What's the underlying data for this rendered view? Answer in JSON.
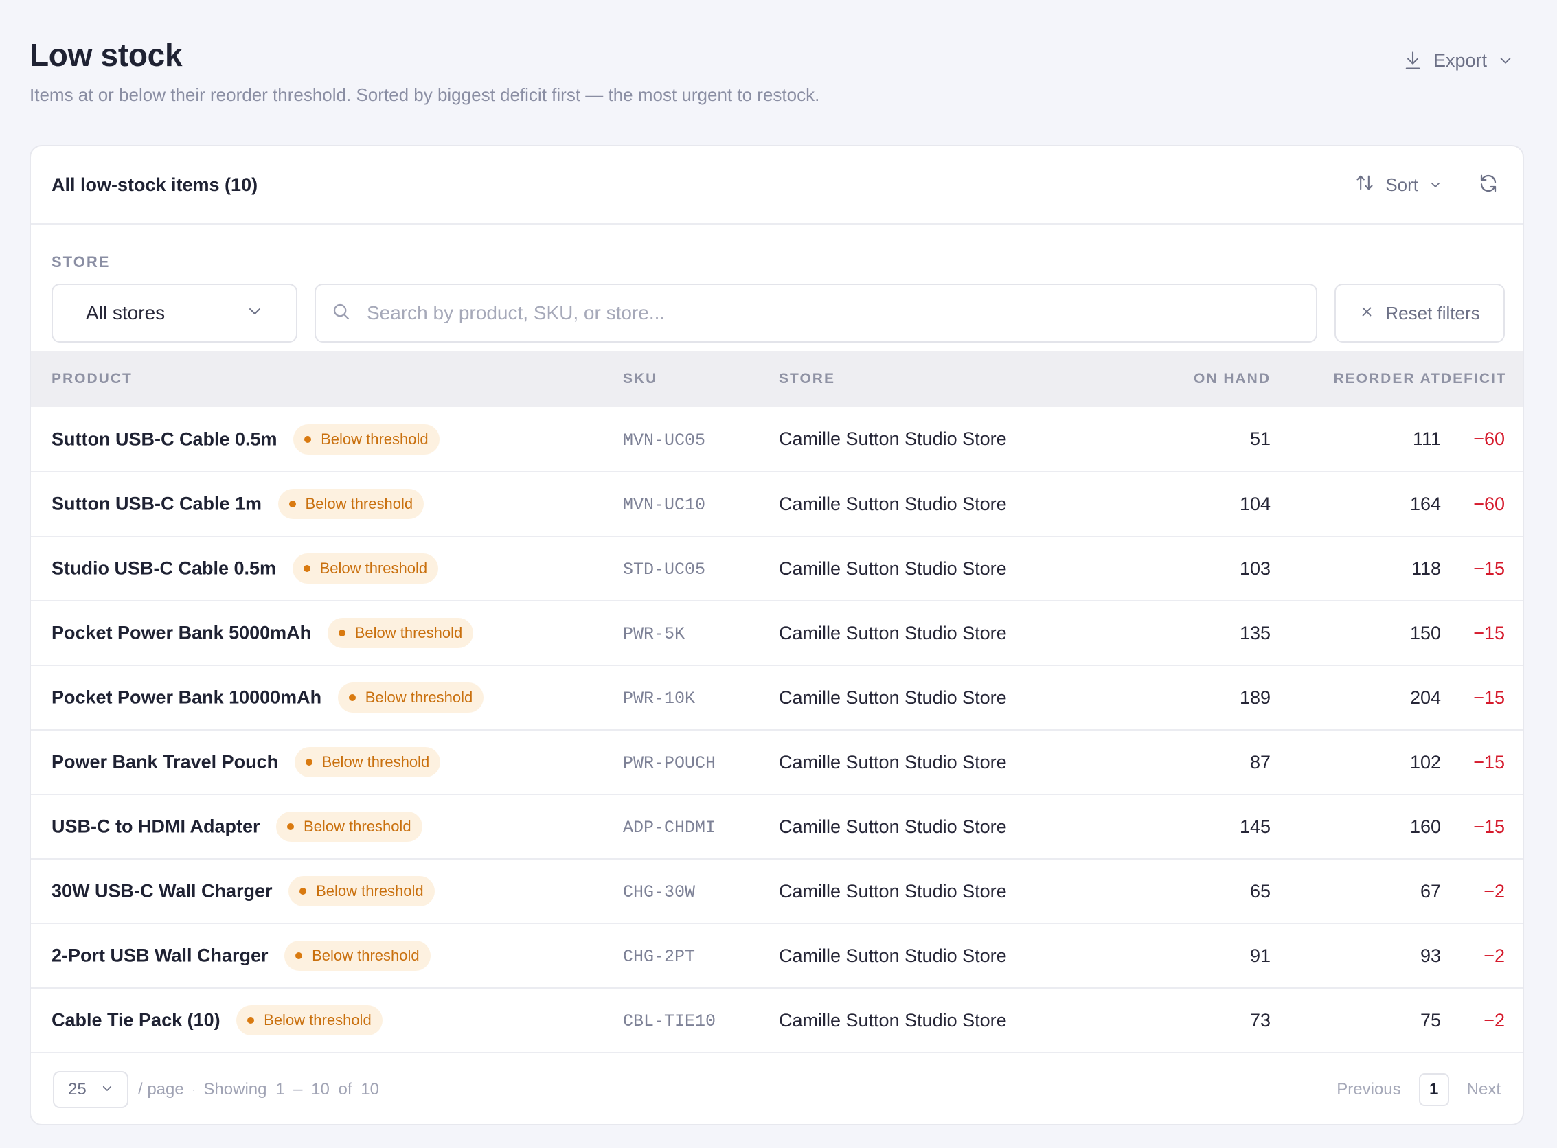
{
  "header": {
    "title": "Low stock",
    "subtitle": "Items at or below their reorder threshold. Sorted by biggest deficit first — the most urgent to restock.",
    "export_label": "Export"
  },
  "card": {
    "title": "All low-stock items (10)",
    "sort_label": "Sort"
  },
  "filters": {
    "store_label": "STORE",
    "store_value": "All stores",
    "search_placeholder": "Search by product, SKU, or store...",
    "reset_label": "Reset filters"
  },
  "table": {
    "columns": [
      "PRODUCT",
      "SKU",
      "STORE",
      "ON HAND",
      "REORDER AT",
      "DEFICIT"
    ],
    "badge_label": "Below threshold",
    "rows": [
      {
        "product": "Sutton USB-C Cable 0.5m",
        "sku": "MVN-UC05",
        "store": "Camille Sutton Studio Store",
        "on_hand": "51",
        "reorder_at": "111",
        "deficit": "−60"
      },
      {
        "product": "Sutton USB-C Cable 1m",
        "sku": "MVN-UC10",
        "store": "Camille Sutton Studio Store",
        "on_hand": "104",
        "reorder_at": "164",
        "deficit": "−60"
      },
      {
        "product": "Studio USB-C Cable 0.5m",
        "sku": "STD-UC05",
        "store": "Camille Sutton Studio Store",
        "on_hand": "103",
        "reorder_at": "118",
        "deficit": "−15"
      },
      {
        "product": "Pocket Power Bank 5000mAh",
        "sku": "PWR-5K",
        "store": "Camille Sutton Studio Store",
        "on_hand": "135",
        "reorder_at": "150",
        "deficit": "−15"
      },
      {
        "product": "Pocket Power Bank 10000mAh",
        "sku": "PWR-10K",
        "store": "Camille Sutton Studio Store",
        "on_hand": "189",
        "reorder_at": "204",
        "deficit": "−15"
      },
      {
        "product": "Power Bank Travel Pouch",
        "sku": "PWR-POUCH",
        "store": "Camille Sutton Studio Store",
        "on_hand": "87",
        "reorder_at": "102",
        "deficit": "−15"
      },
      {
        "product": "USB-C to HDMI Adapter",
        "sku": "ADP-CHDMI",
        "store": "Camille Sutton Studio Store",
        "on_hand": "145",
        "reorder_at": "160",
        "deficit": "−15"
      },
      {
        "product": "30W USB-C Wall Charger",
        "sku": "CHG-30W",
        "store": "Camille Sutton Studio Store",
        "on_hand": "65",
        "reorder_at": "67",
        "deficit": "−2"
      },
      {
        "product": "2-Port USB Wall Charger",
        "sku": "CHG-2PT",
        "store": "Camille Sutton Studio Store",
        "on_hand": "91",
        "reorder_at": "93",
        "deficit": "−2"
      },
      {
        "product": "Cable Tie Pack (10)",
        "sku": "CBL-TIE10",
        "store": "Camille Sutton Studio Store",
        "on_hand": "73",
        "reorder_at": "75",
        "deficit": "−2"
      }
    ]
  },
  "footer": {
    "per_page": "25",
    "per_page_label": "/ page",
    "separator": "·",
    "showing": "Showing 1 – 10 of 10",
    "previous": "Previous",
    "current_page": "1",
    "next": "Next"
  },
  "colors": {
    "background": "#f4f5fa",
    "badge_bg": "#fdf1e0",
    "badge_text": "#c9700e",
    "deficit": "#d5192b"
  },
  "icons": [
    "download-icon",
    "chevron-down-icon",
    "sort-icon",
    "refresh-icon",
    "search-icon",
    "close-icon",
    "dot-icon"
  ]
}
